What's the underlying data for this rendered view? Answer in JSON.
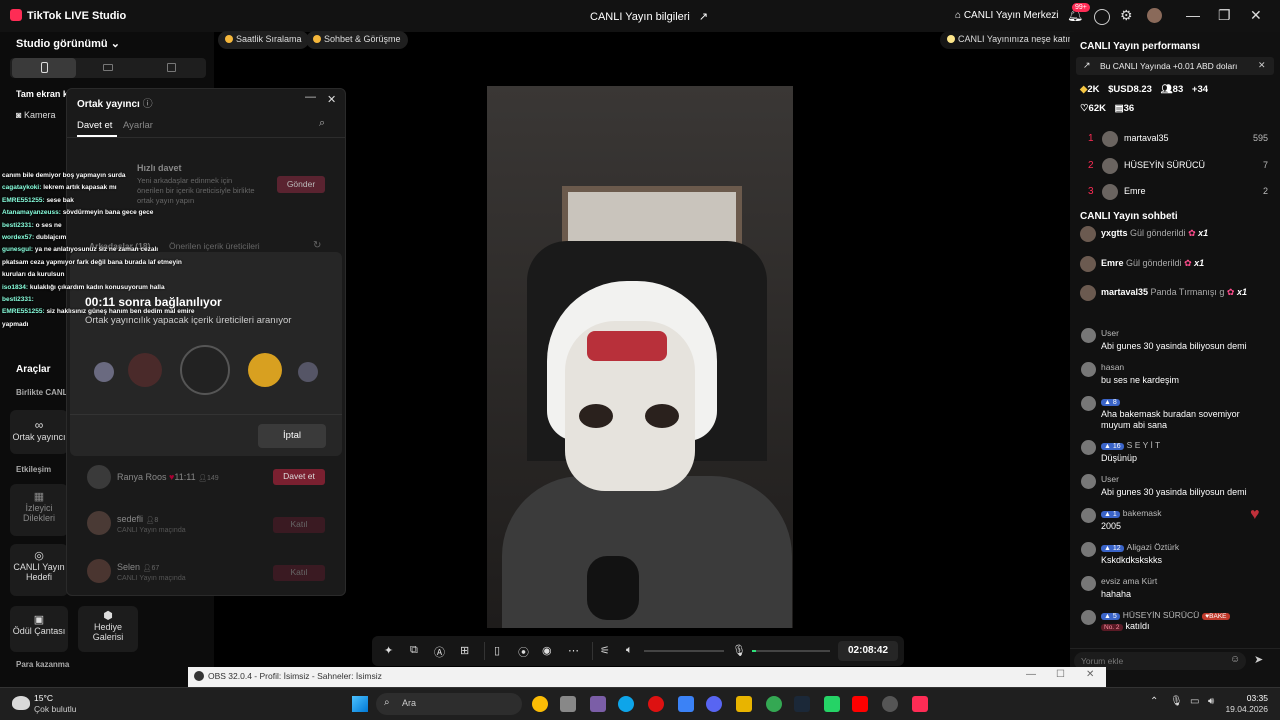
{
  "titlebar": {
    "app_name": "TikTok LIVE Studio",
    "center_title": "CANLI Yayın bilgileri",
    "live_center": "CANLI Yayın Merkezi",
    "notif_badge": "99+"
  },
  "left": {
    "studio_view": "Studio görünümü",
    "fullscreen": "Tam ekran k",
    "camera": "Kamera",
    "tools_title": "Araçlar",
    "together_live": "Birlikte CANLI",
    "co_host": "Ortak yayıncı",
    "engagement": "Etkileşim",
    "viewer_wishes": "İzleyici Dilekleri",
    "live_goal": "CANLI Yayın Hedefi",
    "reward_bag": "Ödül Çantası",
    "gift_gallery": "Hediye Galerisi",
    "earn_money": "Para kazanma"
  },
  "stage": {
    "chip_hourly": "Saatlik Sıralama",
    "chip_chat": "Sohbet & Görüşme",
    "chip_fun": "CANLI Yayınınıza neşe katın"
  },
  "modal": {
    "title": "Ortak yayıncı",
    "tab_invite": "Davet et",
    "tab_settings": "Ayarlar",
    "quick_invite_title": "Hızlı davet",
    "quick_invite_desc": "Yeni arkadaşlar edinmek için önerilen bir içerik üreticisiyle birlikte ortak yayın yapın",
    "send_button": "Gönder",
    "friends_tab": "Arkadaşlar (18)",
    "suggested_tab": "Önerilen içerik üreticileri",
    "rows": [
      {
        "name": "Ranya Roos",
        "extra": "11:11",
        "count": "149",
        "action": "Davet et"
      },
      {
        "name": "sedefli",
        "count": "8",
        "sub": "CANLI Yayın maçında",
        "action": "Katıl"
      },
      {
        "name": "Selen",
        "count": "67",
        "sub": "CANLI Yayın maçında",
        "action": "Katıl"
      }
    ]
  },
  "connect": {
    "countdown": "00:11 sonra bağlanılıyor",
    "searching": "Ortak yayıncılık yapacak içerik üreticileri aranıyor",
    "cancel": "İptal"
  },
  "overlay_chat": [
    {
      "name": "",
      "text": "canım bile demiyor boş yapmayın surda"
    },
    {
      "name": "cagataykoki:",
      "text": "lekrem artık kapasak mı"
    },
    {
      "name": "EMRE551255:",
      "text": "sese bak"
    },
    {
      "name": "Atanamayanzeuss:",
      "text": "sövdürmeyin bana gece gece"
    },
    {
      "name": "besti2331:",
      "text": "o ses ne"
    },
    {
      "name": "wordex57:",
      "text": "dublajcım"
    },
    {
      "name": "gunesgul:",
      "text": "ya ne anlatıyosunuz siz ne zaman cezalı"
    },
    {
      "name": "",
      "text": "pkatsam ceza yapmıyor fark değil bana burada laf etmeyin"
    },
    {
      "name": "",
      "text": "kuruları da kurulsun"
    },
    {
      "name": "iso1834:",
      "text": "kulaklığı çıkardım kadın konusuyorum halla"
    },
    {
      "name": "besti2331:",
      "text": ""
    },
    {
      "name": "EMRE551255:",
      "text": "siz haklısınız güneş hanım ben dedim mal emire"
    },
    {
      "name": "",
      "text": "yapmadı"
    }
  ],
  "right": {
    "perf_title": "CANLI Yayın performansı",
    "banner": "Bu CANLI Yayında +0.01 ABD doları",
    "stats": {
      "diamonds": "2K",
      "usd": "USD8.23",
      "viewers": "83",
      "follows": "34",
      "likes": "62K",
      "gifts": "36"
    },
    "ranking": [
      {
        "rank": "1",
        "name": "martaval35",
        "score": "595"
      },
      {
        "rank": "2",
        "name": "HÜSEYİN SÜRÜCÜ",
        "score": "7"
      },
      {
        "rank": "3",
        "name": "Emre",
        "score": "2"
      }
    ],
    "chat_title": "CANLI Yayın sohbeti",
    "gifts": [
      {
        "name": "yxgtts",
        "action": "Gül gönderildi",
        "mult": "x1"
      },
      {
        "name": "Emre",
        "action": "Gül gönderildi",
        "mult": "x1"
      },
      {
        "name": "martaval35",
        "action": "Panda Tırmanışı g",
        "mult": "x1"
      }
    ],
    "messages": [
      {
        "user": "User",
        "badge": "",
        "text": "Abi gunes 30 yasinda biliyosun demi"
      },
      {
        "user": "hasan",
        "badge": "",
        "text": "bu ses ne kardeşim"
      },
      {
        "user": "",
        "badge": "8",
        "text": "Aha bakemask buradan sovemiyor muyum abi sana"
      },
      {
        "user": "S E Y İ T",
        "badge": "16",
        "text": "Düşünüp"
      },
      {
        "user": "User",
        "badge": "",
        "text": "Abi gunes 30 yasinda biliyosun demi"
      },
      {
        "user": "bakemask",
        "badge": "1",
        "text": "2005"
      },
      {
        "user": "Aligazi Öztürk",
        "badge": "12",
        "text": "Kskdkdkskskks"
      },
      {
        "user": "evsiz ama Kürt",
        "badge": "",
        "text": "hahaha"
      },
      {
        "user": "HÜSEYİN SÜRÜCÜ",
        "badge": "5",
        "text": "katıldı"
      }
    ],
    "joined_tag": "BAKE",
    "joined_rank": "No. 2",
    "comment_placeholder": "Yorum ekle"
  },
  "bottombar": {
    "timer": "02:08:42",
    "volume_level": 0.05
  },
  "obs": {
    "title": "OBS 32.0.4 - Profil: İsimsiz - Sahneler: İsimsiz"
  },
  "taskbar": {
    "temp": "15°C",
    "weather": "Çok bulutlu",
    "search": "Ara",
    "time": "03:35",
    "date": "19.04.2026"
  }
}
